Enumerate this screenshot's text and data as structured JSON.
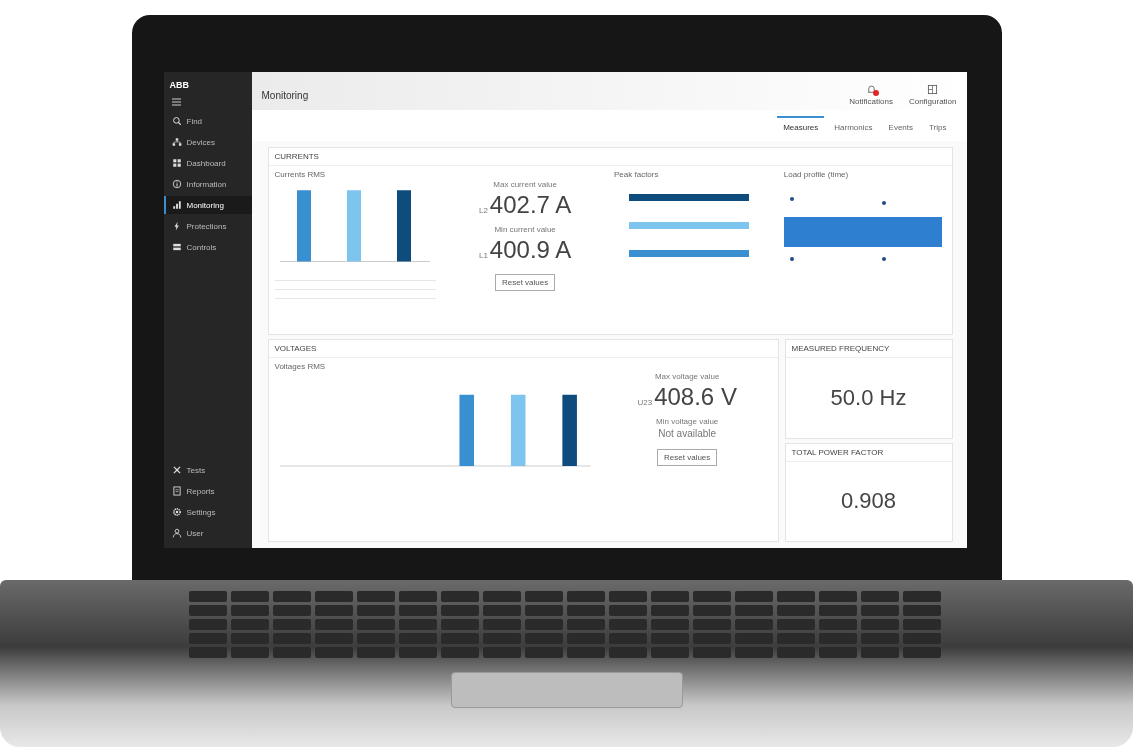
{
  "window": {
    "title": "Monitoring"
  },
  "sidebar": {
    "logo": "ABB",
    "items": [
      {
        "label": "Find",
        "selected": false
      },
      {
        "label": "Devices",
        "selected": false
      },
      {
        "label": "Dashboard",
        "selected": false
      },
      {
        "label": "Information",
        "selected": false
      },
      {
        "label": "Monitoring",
        "selected": true
      },
      {
        "label": "Protections",
        "selected": false
      },
      {
        "label": "Controls",
        "selected": false
      }
    ],
    "bottom_items": [
      {
        "label": "Tests",
        "selected": false
      },
      {
        "label": "Reports",
        "selected": false
      },
      {
        "label": "Settings",
        "selected": false
      },
      {
        "label": "User",
        "selected": false
      }
    ]
  },
  "toolbar": [
    {
      "label": "Notifications",
      "alert": true
    },
    {
      "label": "Configuration",
      "alert": false
    }
  ],
  "tabs": [
    {
      "label": "Measures",
      "selected": true
    },
    {
      "label": "Harmonics",
      "selected": false
    },
    {
      "label": "Events",
      "selected": false
    },
    {
      "label": "Trips",
      "selected": false
    }
  ],
  "currents": {
    "title": "CURRENTS",
    "chart_title": "Currents RMS",
    "max": {
      "label": "Max current value",
      "phase": "L2",
      "value": "402.7 A"
    },
    "min": {
      "label": "Min current value",
      "phase": "L1",
      "value": "400.9 A"
    },
    "button": "Reset values",
    "peak_title": "Peak factors",
    "load_title": "Load profile (time)"
  },
  "voltages": {
    "title": "VOLTAGES",
    "chart_title": "Voltages RMS",
    "max": {
      "label": "Max voltage value",
      "phase": "U23",
      "value": "408.6 V"
    },
    "min": {
      "label": "Min voltage value",
      "value": "Not available"
    },
    "button": "Reset values"
  },
  "frequency": {
    "title": "MEASURED FREQUENCY",
    "value": "50.0 Hz"
  },
  "power_factor": {
    "title": "TOTAL POWER FACTOR",
    "value": "0.908"
  }
}
